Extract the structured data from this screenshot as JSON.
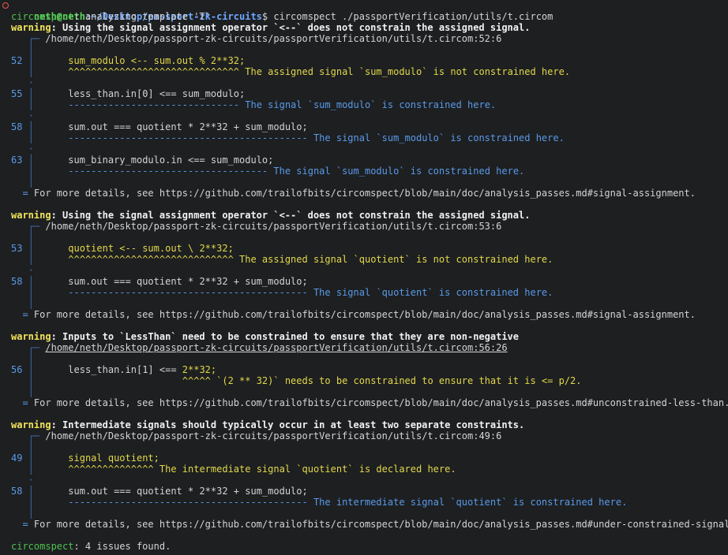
{
  "prompt": {
    "user": "neth@neth",
    "path": ":~/Desktop/passport-zk-circuits",
    "symbol": "$ ",
    "command": "circomspect ./passportVerification/utils/t.circom"
  },
  "tool": {
    "name": "circomspect",
    "analyzing": ": analyzing template 'T'",
    "summary": ": 4 issues found."
  },
  "frame": {
    "corner": "┌─",
    "bar": "│",
    "more": "="
  },
  "warnings": [
    {
      "label": "warning",
      "message": ": Using the signal assignment operator `<--` does not constrain the assigned signal.",
      "location": "/home/neth/Desktop/passport-zk-circuits/passportVerification/utils/t.circom:52:6",
      "snippets": [
        {
          "line_no": "52",
          "code": "sum_modulo <-- sum.out % 2**32;",
          "marker": "^^^^^^^^^^^^^^^^^^^^^^^^^^^^^^",
          "note": " The assigned signal `sum_modulo` is not constrained here."
        },
        {
          "line_no": "55",
          "code": "less_than.in[0] <== sum_modulo;",
          "marker": "------------------------------",
          "note": " The signal `sum_modulo` is constrained here."
        },
        {
          "line_no": "58",
          "code": "sum.out === quotient * 2**32 + sum_modulo;",
          "marker": "------------------------------------------",
          "note": " The signal `sum_modulo` is constrained here."
        },
        {
          "line_no": "63",
          "code": "sum_binary_modulo.in <== sum_modulo;",
          "marker": "-----------------------------------",
          "note": " The signal `sum_modulo` is constrained here."
        }
      ],
      "more": " For more details, see https://github.com/trailofbits/circomspect/blob/main/doc/analysis_passes.md#signal-assignment."
    },
    {
      "label": "warning",
      "message": ": Using the signal assignment operator `<--` does not constrain the assigned signal.",
      "location": "/home/neth/Desktop/passport-zk-circuits/passportVerification/utils/t.circom:53:6",
      "snippets": [
        {
          "line_no": "53",
          "code": "quotient <-- sum.out \\ 2**32;",
          "marker": "^^^^^^^^^^^^^^^^^^^^^^^^^^^^^",
          "note": " The assigned signal `quotient` is not constrained here."
        },
        {
          "line_no": "58",
          "code": "sum.out === quotient * 2**32 + sum_modulo;",
          "marker": "------------------------------------------",
          "note": " The signal `quotient` is constrained here."
        }
      ],
      "more": " For more details, see https://github.com/trailofbits/circomspect/blob/main/doc/analysis_passes.md#signal-assignment."
    },
    {
      "label": "warning",
      "message": ": Inputs to `LessThan` need to be constrained to ensure that they are non-negative",
      "location": "/home/neth/Desktop/passport-zk-circuits/passportVerification/utils/t.circom:56:26",
      "snippets": [
        {
          "line_no": "56",
          "code": "less_than.in[1] <== ",
          "code_highlight": "2**32;",
          "marker_pad": "                    ",
          "marker": "^^^^^",
          "note": " `(2 ** 32)` needs to be constrained to ensure that it is <= p/2."
        }
      ],
      "more": " For more details, see https://github.com/trailofbits/circomspect/blob/main/doc/analysis_passes.md#unconstrained-less-than."
    },
    {
      "label": "warning",
      "message": ": Intermediate signals should typically occur in at least two separate constraints.",
      "location": "/home/neth/Desktop/passport-zk-circuits/passportVerification/utils/t.circom:49:6",
      "snippets": [
        {
          "line_no": "49",
          "code": "signal quotient;",
          "marker": "^^^^^^^^^^^^^^^",
          "note": " The intermediate signal `quotient` is declared here."
        },
        {
          "line_no": "58",
          "code": "sum.out === quotient * 2**32 + sum_modulo;",
          "marker": "------------------------------------------",
          "note": " The intermediate signal `quotient` is constrained here."
        }
      ],
      "more": " For more details, see https://github.com/trailofbits/circomspect/blob/main/doc/analysis_passes.md#under-constrained-signal."
    }
  ]
}
